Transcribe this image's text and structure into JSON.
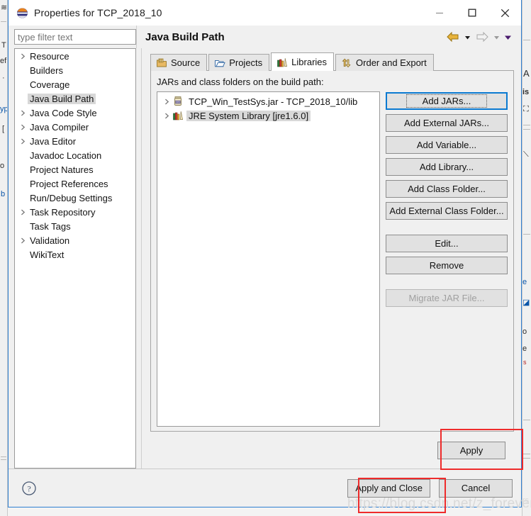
{
  "window": {
    "title": "Properties for TCP_2018_10",
    "icon": "eclipse-icon",
    "controls": {
      "minimize": "minimize-icon",
      "maximize": "maximize-icon",
      "close": "close-icon"
    }
  },
  "filter": {
    "placeholder": "type filter text",
    "value": ""
  },
  "page": {
    "title": "Java Build Path"
  },
  "nav": {
    "back": "back-arrow-icon",
    "back_menu": "chevron-down-icon",
    "forward": "forward-arrow-icon",
    "forward_menu": "chevron-down-icon",
    "view_menu": "chevron-down-icon"
  },
  "sidebar": {
    "items": [
      {
        "label": "Resource",
        "expandable": true,
        "selected": false
      },
      {
        "label": "Builders",
        "expandable": false,
        "selected": false
      },
      {
        "label": "Coverage",
        "expandable": false,
        "selected": false
      },
      {
        "label": "Java Build Path",
        "expandable": false,
        "selected": true
      },
      {
        "label": "Java Code Style",
        "expandable": true,
        "selected": false
      },
      {
        "label": "Java Compiler",
        "expandable": true,
        "selected": false
      },
      {
        "label": "Java Editor",
        "expandable": true,
        "selected": false
      },
      {
        "label": "Javadoc Location",
        "expandable": false,
        "selected": false
      },
      {
        "label": "Project Natures",
        "expandable": false,
        "selected": false
      },
      {
        "label": "Project References",
        "expandable": false,
        "selected": false
      },
      {
        "label": "Run/Debug Settings",
        "expandable": false,
        "selected": false
      },
      {
        "label": "Task Repository",
        "expandable": true,
        "selected": false
      },
      {
        "label": "Task Tags",
        "expandable": false,
        "selected": false
      },
      {
        "label": "Validation",
        "expandable": true,
        "selected": false
      },
      {
        "label": "WikiText",
        "expandable": false,
        "selected": false
      }
    ]
  },
  "tabs": [
    {
      "label": "Source",
      "icon": "source-folder-icon",
      "active": false
    },
    {
      "label": "Projects",
      "icon": "open-folder-icon",
      "active": false
    },
    {
      "label": "Libraries",
      "icon": "books-icon",
      "active": true
    },
    {
      "label": "Order and Export",
      "icon": "reorder-arrows-icon",
      "active": false
    }
  ],
  "libraries": {
    "list_label": "JARs and class folders on the build path:",
    "entries": [
      {
        "label": "TCP_Win_TestSys.jar - TCP_2018_10/lib",
        "icon": "jar-icon",
        "selected": false
      },
      {
        "label": "JRE System Library [jre1.6.0]",
        "icon": "books-icon",
        "selected": true
      }
    ],
    "buttons": [
      {
        "label": "Add JARs...",
        "state": "focused"
      },
      {
        "label": "Add External JARs...",
        "state": "enabled"
      },
      {
        "label": "Add Variable...",
        "state": "enabled"
      },
      {
        "label": "Add Library...",
        "state": "enabled"
      },
      {
        "label": "Add Class Folder...",
        "state": "enabled"
      },
      {
        "label": "Add External Class Folder...",
        "state": "enabled"
      }
    ],
    "buttons2": [
      {
        "label": "Edit...",
        "state": "enabled"
      },
      {
        "label": "Remove",
        "state": "enabled"
      }
    ],
    "buttons3": [
      {
        "label": "Migrate JAR File...",
        "state": "disabled"
      }
    ]
  },
  "apply": {
    "label": "Apply"
  },
  "footer": {
    "help": "help-icon",
    "apply_and_close": "Apply and Close",
    "cancel": "Cancel"
  },
  "annotations": {
    "highlight_color": "#ee2b2b",
    "boxes": [
      "Apply",
      "Apply and Close"
    ]
  },
  "watermark": {
    "text": "https://blog.csdn.net/z_forevers"
  },
  "background": {
    "left_fragments": [
      "T",
      "ef",
      "·",
      "yp",
      "[",
      "o",
      "b"
    ],
    "right_fragments": [
      "A",
      "is",
      "e",
      "o",
      "e",
      "s"
    ]
  }
}
